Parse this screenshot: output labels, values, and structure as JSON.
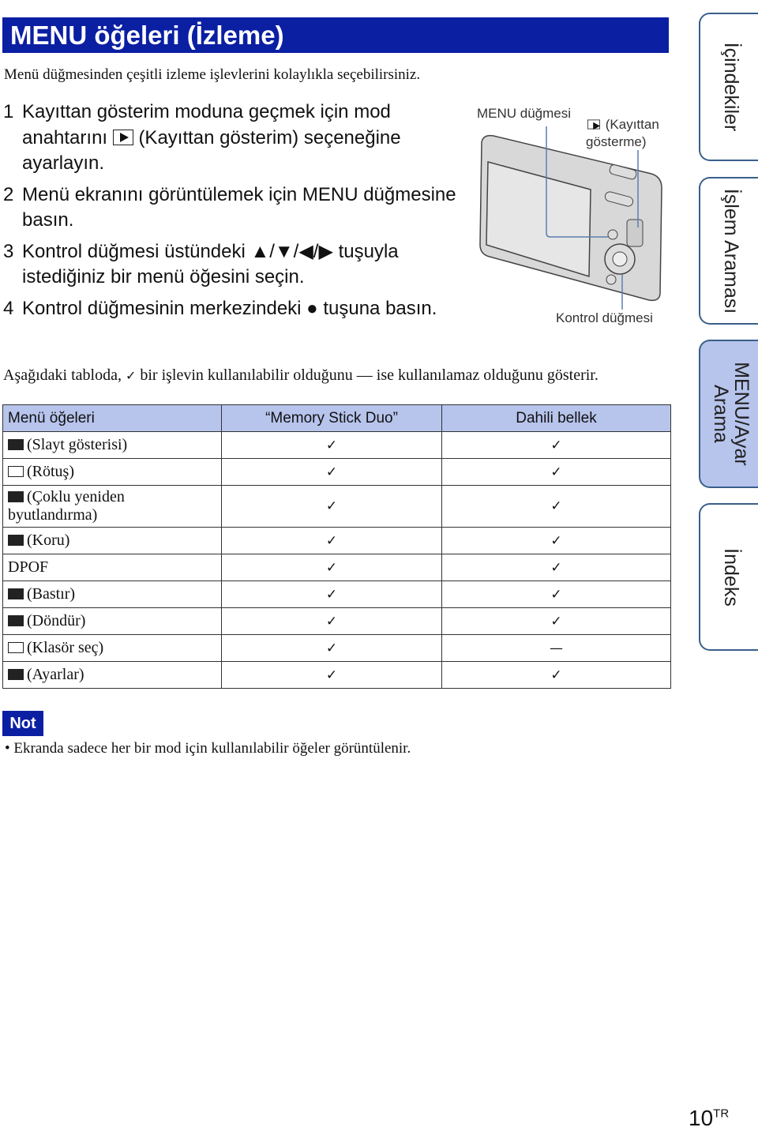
{
  "title": "MENU öğeleri (İzleme)",
  "intro": "Menü düğmesinden çeşitli izleme işlevlerini kolaylıkla seçebilirsiniz.",
  "steps": [
    {
      "n": "1",
      "a": "Kayıttan gösterim moduna geçmek için mod anahtarını",
      "b": "(Kayıttan gösterim) seçeneğine ayarlayın."
    },
    {
      "n": "2",
      "a": "Menü ekranını görüntülemek için MENU düğmesine basın."
    },
    {
      "n": "3",
      "a": "Kontrol düğmesi üstündeki ▲/▼/◀/▶ tuşuyla istediğiniz bir menü öğesini seçin."
    },
    {
      "n": "4",
      "a": "Kontrol düğmesinin merkezindeki ● tuşuna basın."
    }
  ],
  "figure": {
    "menu_label": "MENU düğmesi",
    "play_label": "(Kayıttan gösterme)",
    "control_label": "Kontrol düğmesi"
  },
  "description": {
    "a": "Aşağıdaki tabloda,",
    "check": "✓",
    "b": "bir işlevin kullanılabilir olduğunu — ise kullanılamaz olduğunu gösterir."
  },
  "table": {
    "headers": [
      "Menü öğeleri",
      "“Memory Stick Duo”",
      "Dahili bellek"
    ],
    "rows": [
      {
        "icon": "slideshow-icon",
        "label": "(Slayt gösterisi)",
        "msd": "✓",
        "internal": "✓"
      },
      {
        "icon": "retouch-icon",
        "label": "(Rötuş)",
        "msd": "✓",
        "internal": "✓"
      },
      {
        "icon": "multi-resize-icon",
        "label": "(Çoklu yeniden byutlandırma)",
        "msd": "✓",
        "internal": "✓"
      },
      {
        "icon": "protect-key-icon",
        "label": "(Koru)",
        "msd": "✓",
        "internal": "✓"
      },
      {
        "icon": "",
        "label": "DPOF",
        "msd": "✓",
        "internal": "✓"
      },
      {
        "icon": "print-icon",
        "label": "(Bastır)",
        "msd": "✓",
        "internal": "✓"
      },
      {
        "icon": "rotate-icon",
        "label": "(Döndür)",
        "msd": "✓",
        "internal": "✓"
      },
      {
        "icon": "folder-icon",
        "label": "(Klasör seç)",
        "msd": "✓",
        "internal": "—"
      },
      {
        "icon": "toolbox-icon",
        "label": "(Ayarlar)",
        "msd": "✓",
        "internal": "✓"
      }
    ]
  },
  "note": {
    "label": "Not",
    "text": "Ekranda sadece her bir mod için kullanılabilir öğeler görüntülenir."
  },
  "side_tabs": [
    {
      "label": "İçindekiler",
      "active": false
    },
    {
      "label": "İşlem Araması",
      "active": false
    },
    {
      "label": "MENU/Ayar Arama",
      "active": true
    },
    {
      "label": "İndeks",
      "active": false
    }
  ],
  "page": {
    "number": "10",
    "suffix": "TR"
  },
  "colors": {
    "accent": "#0b1fa3",
    "header_fill": "#b7c4ec"
  }
}
